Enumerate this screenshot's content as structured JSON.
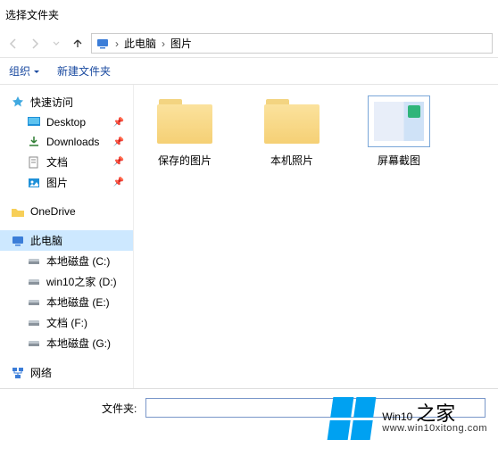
{
  "title": "选择文件夹",
  "breadcrumb": {
    "root": "此电脑",
    "current": "图片"
  },
  "toolbar": {
    "organize": "组织",
    "newfolder": "新建文件夹"
  },
  "sidebar": {
    "quick_access": "快速访问",
    "desktop": "Desktop",
    "downloads": "Downloads",
    "documents": "文档",
    "pictures": "图片",
    "onedrive": "OneDrive",
    "this_pc": "此电脑",
    "drive_c": "本地磁盘 (C:)",
    "drive_d": "win10之家 (D:)",
    "drive_e": "本地磁盘 (E:)",
    "drive_f": "文档 (F:)",
    "drive_g": "本地磁盘 (G:)",
    "network": "网络"
  },
  "folders": {
    "saved": "保存的图片",
    "camera": "本机照片",
    "screenshots": "屏幕截图"
  },
  "bottom": {
    "label": "文件夹:",
    "value": ""
  },
  "watermark": {
    "brand": "Win10",
    "suffix": "之家",
    "url": "www.win10xitong.com"
  }
}
